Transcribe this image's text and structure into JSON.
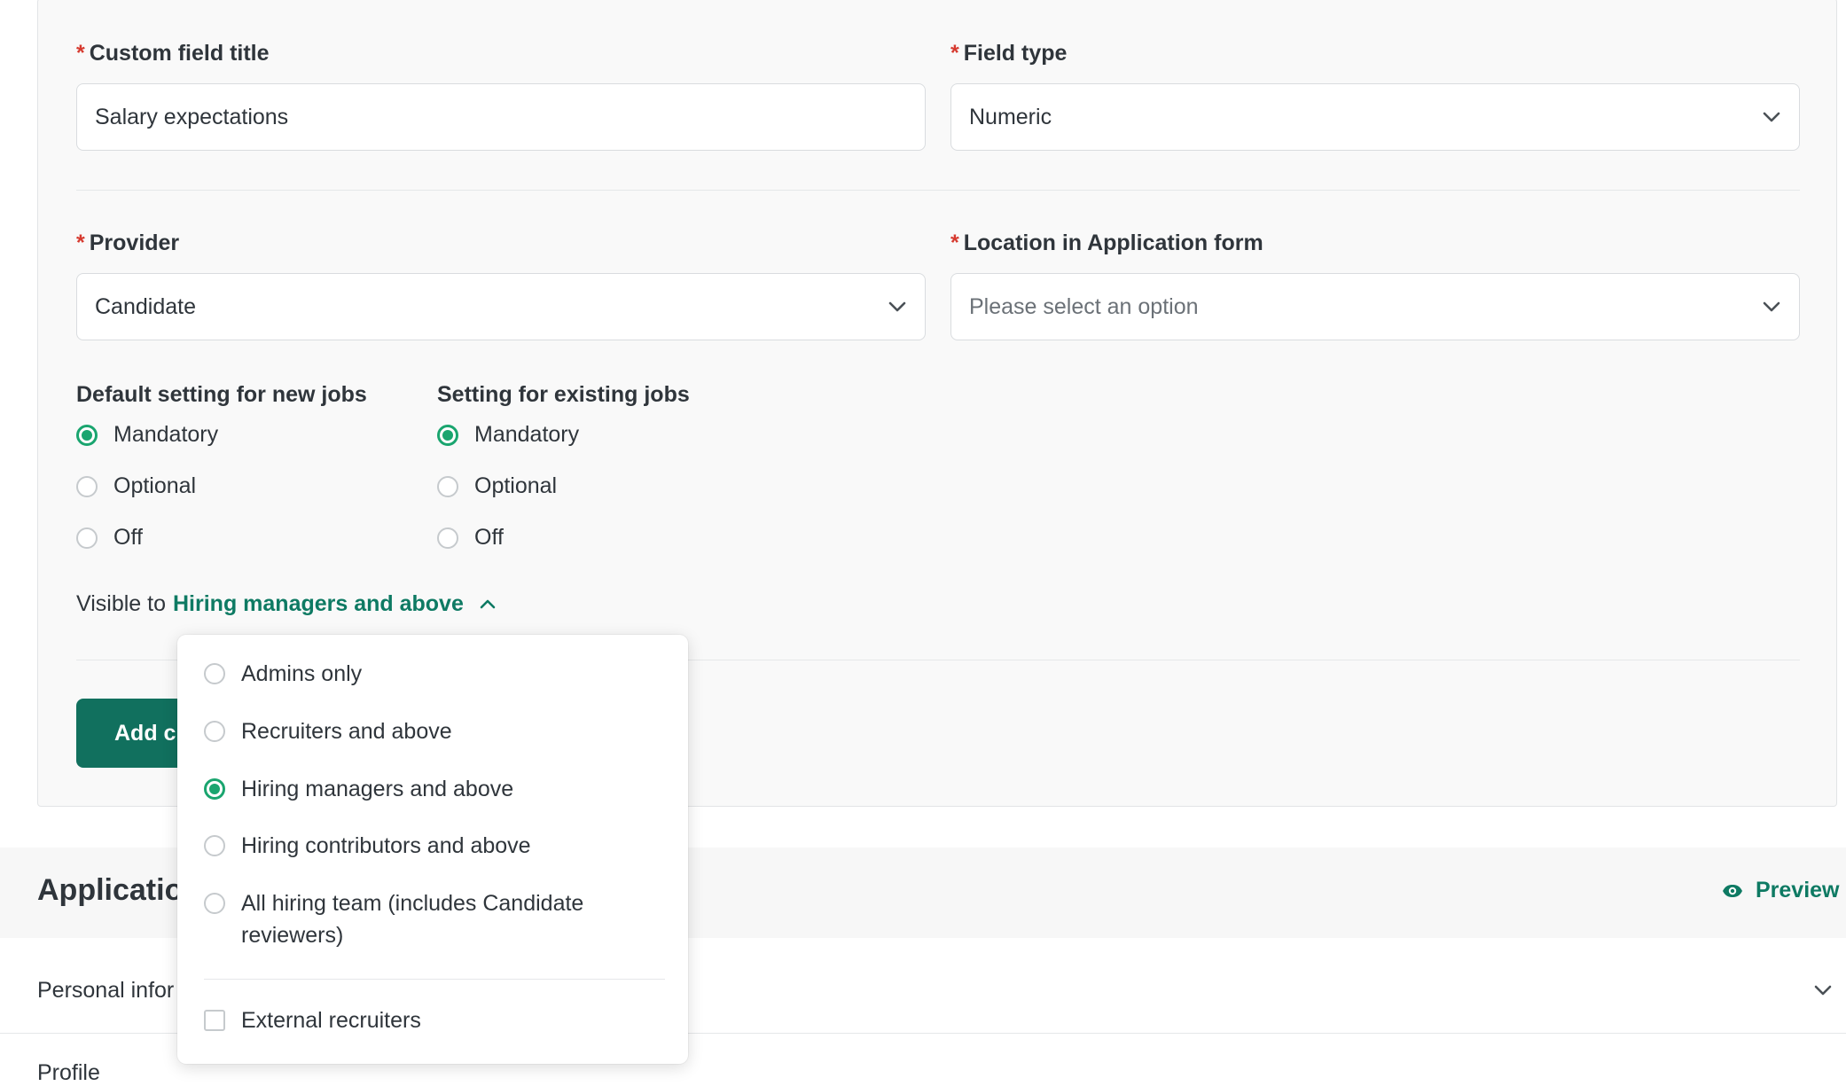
{
  "form": {
    "custom_field_title": {
      "label": "Custom field title",
      "value": "Salary expectations"
    },
    "field_type": {
      "label": "Field type",
      "value": "Numeric"
    },
    "provider": {
      "label": "Provider",
      "value": "Candidate"
    },
    "location": {
      "label": "Location in Application form",
      "placeholder": "Please select an option"
    },
    "required_marker": "*"
  },
  "new_jobs": {
    "title": "Default setting for new jobs",
    "options": [
      "Mandatory",
      "Optional",
      "Off"
    ],
    "selected": "Mandatory"
  },
  "existing_jobs": {
    "title": "Setting for existing jobs",
    "options": [
      "Mandatory",
      "Optional",
      "Off"
    ],
    "selected": "Mandatory"
  },
  "visibility": {
    "prefix": "Visible to",
    "value": "Hiring managers and above",
    "options": [
      "Admins only",
      "Recruiters and above",
      "Hiring managers and above",
      "Hiring contributors and above",
      "All hiring team (includes Candidate reviewers)"
    ],
    "selected": "Hiring managers and above",
    "external_label": "External recruiters"
  },
  "add_button": {
    "label": "Add c"
  },
  "application_section": {
    "title": "Applicatio",
    "preview_label": "Preview",
    "rows": [
      "Personal infor",
      "Profile"
    ]
  },
  "colors": {
    "accent": "#1aa56f",
    "brand": "#11705e",
    "link": "#0e7a63",
    "required": "#d63a2f"
  }
}
